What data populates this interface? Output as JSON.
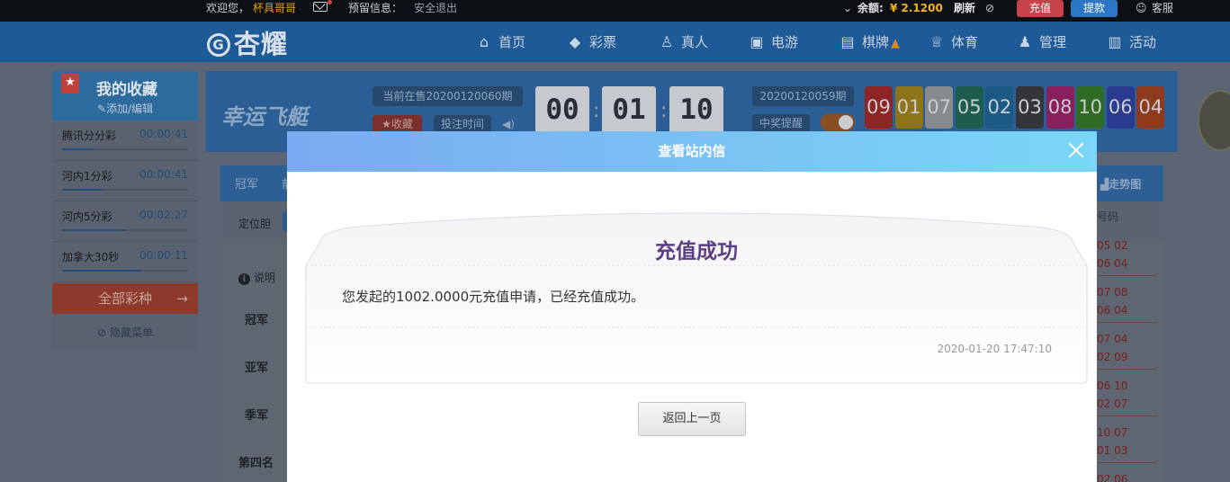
{
  "topbar": {
    "welcome": "欢迎您，",
    "username": "杯具哥哥",
    "reserved_info": "预留信息：",
    "logout": "安全退出",
    "balance_label": "余额:",
    "balance_value": "¥ 2.1200",
    "refresh": "刷新",
    "recharge": "充值",
    "withdraw": "提款",
    "service": "客服"
  },
  "nav": {
    "logo": "杏耀",
    "items": [
      {
        "label": "首页",
        "icon": "home-icon"
      },
      {
        "label": "彩票",
        "icon": "ticket-icon"
      },
      {
        "label": "真人",
        "icon": "dealer-icon"
      },
      {
        "label": "电游",
        "icon": "slot-icon"
      },
      {
        "label": "棋牌",
        "icon": "cards-icon"
      },
      {
        "label": "体育",
        "icon": "trophy-icon"
      },
      {
        "label": "管理",
        "icon": "users-icon"
      },
      {
        "label": "活动",
        "icon": "gift-icon"
      }
    ]
  },
  "sidebar": {
    "title": "我的收藏",
    "edit": "添加/编辑",
    "items": [
      {
        "name": "腾讯分分彩",
        "time": "00:00:41",
        "progress": 0.25
      },
      {
        "name": "河内1分彩",
        "time": "00:00:41",
        "progress": 0.32
      },
      {
        "name": "河内5分彩",
        "time": "00:02:27",
        "progress": 0.5
      },
      {
        "name": "加拿大30秒",
        "time": "00:00:11",
        "progress": 0.63
      }
    ],
    "all_games": "全部彩种",
    "hide_menu": "隐藏菜单"
  },
  "game": {
    "name": "幸运飞艇",
    "current_period": "当前在售20200120060期",
    "favorite": "收藏",
    "bet_time": "投注时间",
    "countdown": [
      "00",
      "01",
      "10"
    ],
    "last_period": "20200120059期",
    "win_remind": "中奖提醒",
    "balls": [
      "09",
      "01",
      "07",
      "05",
      "02",
      "03",
      "08",
      "10",
      "06",
      "04"
    ],
    "ball_colors": [
      "#8f2424",
      "#8f7318",
      "#888b8e",
      "#1d5d4e",
      "#1c5a86",
      "#333538",
      "#8a1f5d",
      "#2f6b22",
      "#2a3a8f",
      "#8f3a1c"
    ]
  },
  "panel": {
    "tabs": [
      "冠军",
      "前"
    ],
    "trend": "走势图",
    "dingweidan": "定位胆",
    "explain": "说明",
    "ranks": [
      "冠军",
      "亚军",
      "季军",
      "第四名"
    ],
    "codes_head": "号码",
    "codes": [
      "05 02",
      "06 04",
      "07 08",
      "06 04",
      "07 04",
      "02 09",
      "06 10",
      "02 07",
      "10 07",
      "01 03",
      "02 06"
    ]
  },
  "modal": {
    "title": "查看站内信",
    "letter_title": "充值成功",
    "letter_body": "您发起的1002.0000元充值申请，已经充值成功。",
    "letter_date": "2020-01-20 17:47:10",
    "back": "返回上一页"
  }
}
